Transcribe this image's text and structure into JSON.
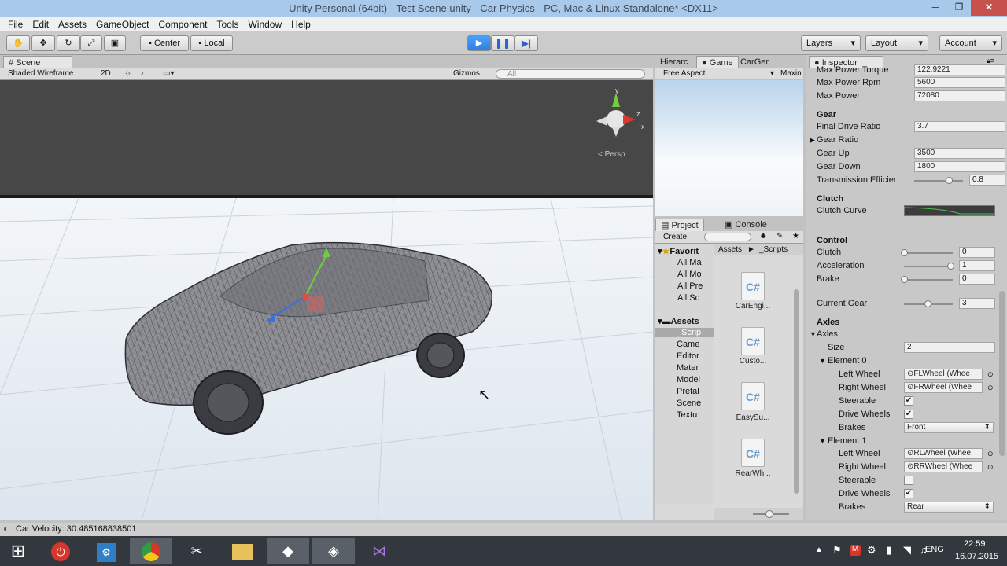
{
  "window": {
    "title": "Unity Personal (64bit) - Test Scene.unity - Car Physics - PC, Mac & Linux Standalone* <DX11>",
    "minimize": "─",
    "maximize": "❐",
    "close": "✕"
  },
  "menu": [
    "File",
    "Edit",
    "Assets",
    "GameObject",
    "Component",
    "Tools",
    "Window",
    "Help"
  ],
  "toolbar": {
    "center": "Center",
    "local": "Local",
    "layers": "Layers",
    "layout": "Layout",
    "account": "Account",
    "play": "▶",
    "pause": "❚❚",
    "step": "▶|"
  },
  "scene": {
    "tab": "Scene",
    "shading": "Shaded Wireframe",
    "mode2d": "2D",
    "gizmos": "Gizmos",
    "search_placeholder": "All",
    "persp": "Persp",
    "gizmo_y": "y",
    "gizmo_z": "z",
    "gizmo_x": "x"
  },
  "game_tabs": {
    "hierarchy": "Hierarc",
    "game": "Game",
    "carger": "CarGer",
    "aspect": "Free Aspect",
    "maximize": "Maxin"
  },
  "project": {
    "tab": "Project",
    "console_tab": "Console",
    "create": "Create",
    "favorites": "Favorit",
    "fav_items": [
      "All Ma",
      "All Mo",
      "All Pre",
      "All Sc"
    ],
    "assets_label": "Assets",
    "asset_folders": [
      "_Scrip",
      "Came",
      "Editor",
      "Mater",
      "Model",
      "Prefal",
      "Scene",
      "Textu"
    ],
    "breadcrumb_assets": "Assets",
    "breadcrumb_arrow": "►",
    "breadcrumb_scripts": "_Scripts",
    "scripts": [
      "CarEngi...",
      "Custo...",
      "EasySu...",
      "RearWh...",
      ""
    ],
    "script_icon": "C#"
  },
  "inspector": {
    "tab": "Inspector",
    "max_power_torque": {
      "label": "Max Power Torque",
      "value": "122.9221"
    },
    "max_power_rpm": {
      "label": "Max Power Rpm",
      "value": "5600"
    },
    "max_power": {
      "label": "Max Power",
      "value": "72080"
    },
    "gear_header": "Gear",
    "final_drive": {
      "label": "Final Drive Ratio",
      "value": "3.7"
    },
    "gear_ratio": {
      "label": "Gear Ratio"
    },
    "gear_up": {
      "label": "Gear Up",
      "value": "3500"
    },
    "gear_down": {
      "label": "Gear Down",
      "value": "1800"
    },
    "transmission": {
      "label": "Transmission Efficier",
      "value": "0.8",
      "fraction": 0.8
    },
    "clutch_header": "Clutch",
    "clutch_curve": {
      "label": "Clutch Curve"
    },
    "control_header": "Control",
    "clutch": {
      "label": "Clutch",
      "value": "0",
      "fraction": 0
    },
    "acceleration": {
      "label": "Acceleration",
      "value": "1",
      "fraction": 1
    },
    "brake": {
      "label": "Brake",
      "value": "0",
      "fraction": 0
    },
    "current_gear": {
      "label": "Current Gear",
      "value": "3",
      "fraction": 0.5
    },
    "axles_header": "Axles",
    "axles_fold": "Axles",
    "size": {
      "label": "Size",
      "value": "2"
    },
    "element0": {
      "label": "Element 0",
      "left_wheel": "FLWheel (Whee",
      "right_wheel": "FRWheel (Whee",
      "steerable": true,
      "drive_wheels": true,
      "brakes": "Front"
    },
    "element1": {
      "label": "Element 1",
      "left_wheel": "RLWheel (Whee",
      "right_wheel": "RRWheel (Whee",
      "steerable": false,
      "drive_wheels": true,
      "brakes": "Rear"
    },
    "labels": {
      "left_wheel": "Left Wheel",
      "right_wheel": "Right Wheel",
      "steerable": "Steerable",
      "drive_wheels": "Drive Wheels",
      "brakes": "Brakes"
    }
  },
  "status": "Car Velocity: 30.485168838501",
  "taskbar": {
    "lang": "ENG",
    "time": "22:59",
    "date": "16.07.2015"
  },
  "icons": {
    "hand": "hand-icon",
    "move": "move-icon",
    "rotate": "rotate-icon",
    "scale": "scale-icon",
    "rect": "rect-icon"
  }
}
